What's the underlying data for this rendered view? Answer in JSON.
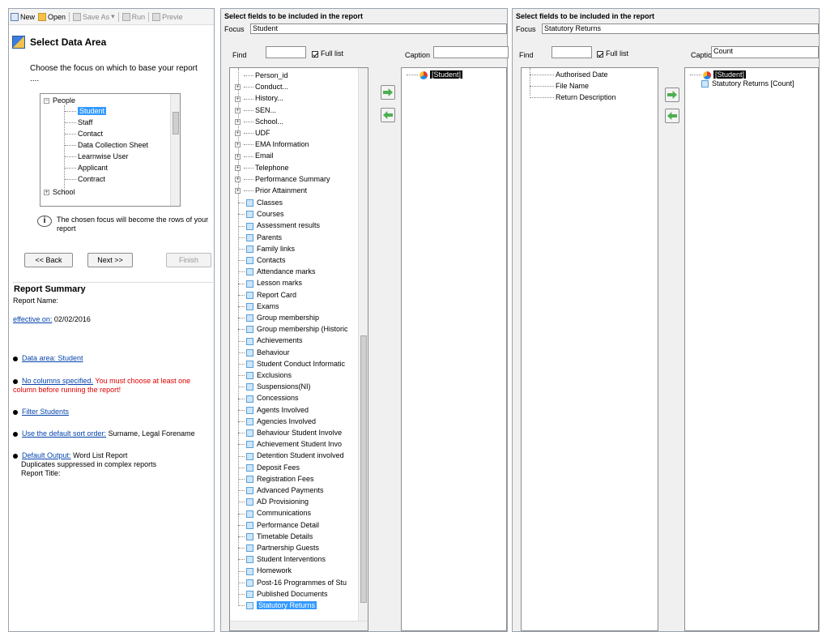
{
  "toolbar": {
    "new": "New",
    "open": "Open",
    "save_as": "Save As",
    "run": "Run",
    "preview": "Previe"
  },
  "left": {
    "area_title": "Select Data Area",
    "instructions": "Choose the focus on which to base your report ....",
    "tree": {
      "people": "People",
      "student": "Student",
      "staff": "Staff",
      "contact": "Contact",
      "data_collection_sheet": "Data Collection Sheet",
      "learnwise_user": "Learnwise User",
      "applicant": "Applicant",
      "contract": "Contract",
      "school": "School"
    },
    "info_text": "The chosen focus will become the rows of your report",
    "back": "<< Back",
    "next": "Next >>",
    "finish": "Finish",
    "summary_title": "Report Summary",
    "report_name": "Report Name:",
    "effective_link": "effective on:",
    "effective_date": "02/02/2016",
    "data_area_link": "Data area: Student",
    "no_columns_link": "No columns specified.",
    "no_columns_msg": "You must choose at least one column before running the report!",
    "filter_link": "Filter Students",
    "sort_link": "Use the default sort order:",
    "sort_value": "Surname, Legal Forename",
    "output_link": "Default Output:",
    "output_value": "Word List Report",
    "duplicates": "Duplicates suppressed in complex reports",
    "report_title": "Report Title:"
  },
  "mid": {
    "title": "Select fields to be included in the report",
    "focus_label": "Focus",
    "focus_value": "Student",
    "find_label": "Find",
    "full_list": "Full list",
    "caption_label": "Caption",
    "expand_items": [
      "Person_id",
      "Conduct...",
      "History...",
      "SEN...",
      "School...",
      "UDF",
      "EMA Information",
      "Email",
      "Telephone",
      "Performance Summary",
      "Prior Attainment"
    ],
    "table_items": [
      "Classes",
      "Courses",
      "Assessment results",
      "Parents",
      "Family links",
      "Contacts",
      "Attendance marks",
      "Lesson marks",
      "Report Card",
      "Exams",
      "Group membership",
      "Group membership (Historic",
      "Achievements",
      "Behaviour",
      "Student Conduct Informatic",
      "Exclusions",
      "Suspensions(NI)",
      "Concessions",
      "Agents Involved",
      "Agencies Involved",
      "Behaviour Student Involve",
      "Achievement Student Invo",
      "Detention Student involved",
      "Deposit Fees",
      "Registration Fees",
      "Advanced Payments",
      "AD Provisioning",
      "Communications",
      "Performance Detail",
      "Timetable Details",
      "Partnership Guests",
      "Student Interventions",
      "Homework",
      "Post-16 Programmes of Stu",
      "Published Documents",
      "Statutory Returns"
    ],
    "selected_root": "[Student]"
  },
  "right": {
    "title": "Select fields to be included in the report",
    "focus_label": "Focus",
    "focus_value": "Statutory Returns",
    "find_label": "Find",
    "full_list": "Full list",
    "caption_label": "Caption",
    "caption_value": "Count",
    "fields": [
      "Authorised Date",
      "File Name",
      "Return Description"
    ],
    "selected_root": "[Student]",
    "selected_child": "Statutory Returns [Count]"
  }
}
